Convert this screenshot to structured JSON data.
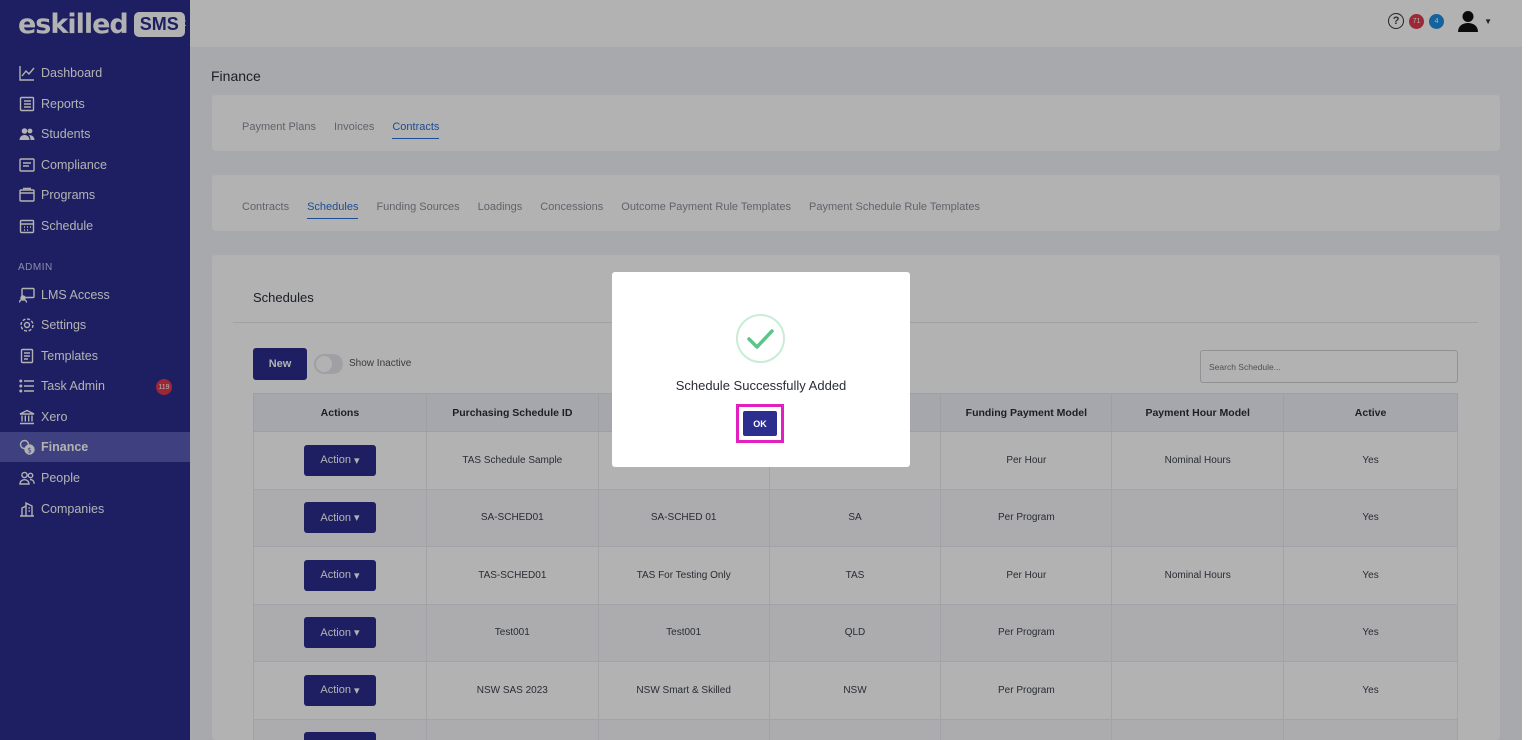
{
  "brand": {
    "name": "eskilled",
    "badge": "SMS"
  },
  "sidebar": {
    "items": [
      {
        "label": "Dashboard",
        "icon": "chart-line-icon"
      },
      {
        "label": "Reports",
        "icon": "report-icon"
      },
      {
        "label": "Students",
        "icon": "users-icon"
      },
      {
        "label": "Compliance",
        "icon": "compliance-icon"
      },
      {
        "label": "Programs",
        "icon": "programs-icon"
      },
      {
        "label": "Schedule",
        "icon": "calendar-icon"
      }
    ],
    "admin_label": "ADMIN",
    "admin_items": [
      {
        "label": "LMS Access",
        "icon": "lms-icon"
      },
      {
        "label": "Settings",
        "icon": "gear-icon"
      },
      {
        "label": "Templates",
        "icon": "template-icon"
      },
      {
        "label": "Task Admin",
        "icon": "list-icon",
        "badge": "119"
      },
      {
        "label": "Xero",
        "icon": "bank-icon"
      },
      {
        "label": "Finance",
        "icon": "finance-icon",
        "active": true
      },
      {
        "label": "People",
        "icon": "people-icon"
      },
      {
        "label": "Companies",
        "icon": "companies-icon"
      }
    ]
  },
  "topbar": {
    "help": "?",
    "notif_red": "71",
    "notif_blue": "4"
  },
  "page": {
    "title": "Finance"
  },
  "finance_tabs": [
    "Payment Plans",
    "Invoices",
    "Contracts"
  ],
  "contract_tabs": [
    "Contracts",
    "Schedules",
    "Funding Sources",
    "Loadings",
    "Concessions",
    "Outcome Payment Rule Templates",
    "Payment Schedule Rule Templates"
  ],
  "schedules": {
    "title": "Schedules",
    "new_label": "New",
    "show_inactive": "Show Inactive",
    "search_placeholder": "Search Schedule...",
    "columns": [
      "Actions",
      "Purchasing Schedule ID",
      "",
      "",
      "Funding Payment Model",
      "Payment Hour Model",
      "Active"
    ],
    "action_label": "Action",
    "rows": [
      [
        "TAS Schedule Sample",
        "",
        "",
        "Per Hour",
        "Nominal Hours",
        "Yes"
      ],
      [
        "SA-SCHED01",
        "SA-SCHED 01",
        "SA",
        "Per Program",
        "",
        "Yes"
      ],
      [
        "TAS-SCHED01",
        "TAS For Testing Only",
        "TAS",
        "Per Hour",
        "Nominal Hours",
        "Yes"
      ],
      [
        "Test001",
        "Test001",
        "QLD",
        "Per Program",
        "",
        "Yes"
      ],
      [
        "NSW SAS 2023",
        "NSW Smart & Skilled",
        "NSW",
        "Per Program",
        "",
        "Yes"
      ]
    ]
  },
  "modal": {
    "message": "Schedule Successfully Added",
    "ok_label": "OK",
    "accent": "#5cc58a"
  },
  "colors": {
    "primary": "#2b2d8f",
    "highlight": "#e21fbf"
  }
}
